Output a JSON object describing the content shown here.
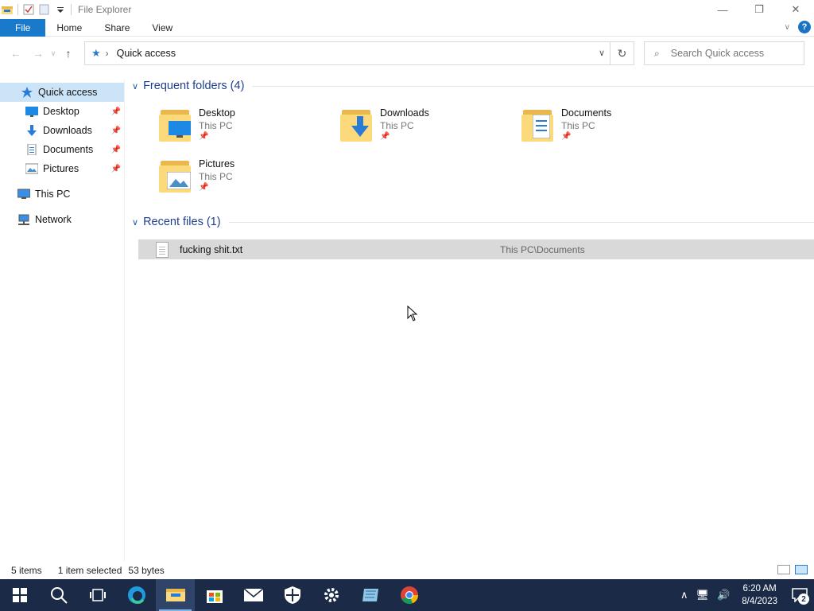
{
  "window": {
    "title": "File Explorer"
  },
  "ribbon": {
    "tabs": [
      "File",
      "Home",
      "Share",
      "View"
    ]
  },
  "address": {
    "location": "Quick access",
    "search_placeholder": "Search Quick access"
  },
  "sidebar": {
    "items": [
      {
        "label": "Quick access",
        "icon": "star-icon",
        "selected": true
      },
      {
        "label": "Desktop",
        "icon": "desktop-icon",
        "pinned": true
      },
      {
        "label": "Downloads",
        "icon": "download-arrow-icon",
        "pinned": true
      },
      {
        "label": "Documents",
        "icon": "documents-icon",
        "pinned": true
      },
      {
        "label": "Pictures",
        "icon": "pictures-icon",
        "pinned": true
      },
      {
        "label": "This PC",
        "icon": "computer-icon"
      },
      {
        "label": "Network",
        "icon": "network-icon"
      }
    ]
  },
  "frequent": {
    "title": "Frequent folders (4)",
    "folders": [
      {
        "name": "Desktop",
        "location": "This PC"
      },
      {
        "name": "Downloads",
        "location": "This PC"
      },
      {
        "name": "Documents",
        "location": "This PC"
      },
      {
        "name": "Pictures",
        "location": "This PC"
      }
    ]
  },
  "recent": {
    "title": "Recent files (1)",
    "files": [
      {
        "name": "fucking shit.txt",
        "path": "This PC\\Documents"
      }
    ]
  },
  "status": {
    "count": "5 items",
    "selected": "1 item selected",
    "size": "53 bytes"
  },
  "taskbar": {
    "apps": [
      "start-icon",
      "search-icon",
      "task-view-icon",
      "edge-icon",
      "file-explorer-icon",
      "store-icon",
      "mail-icon",
      "security-icon",
      "settings-icon",
      "notepad-icon",
      "chrome-icon"
    ],
    "time": "6:20 AM",
    "date": "8/4/2023",
    "notifications": "2"
  },
  "colors": {
    "accent": "#1979ca",
    "selection": "#cce4f7",
    "taskbar": "#1b2b47",
    "group_title": "#1e3f8f"
  }
}
